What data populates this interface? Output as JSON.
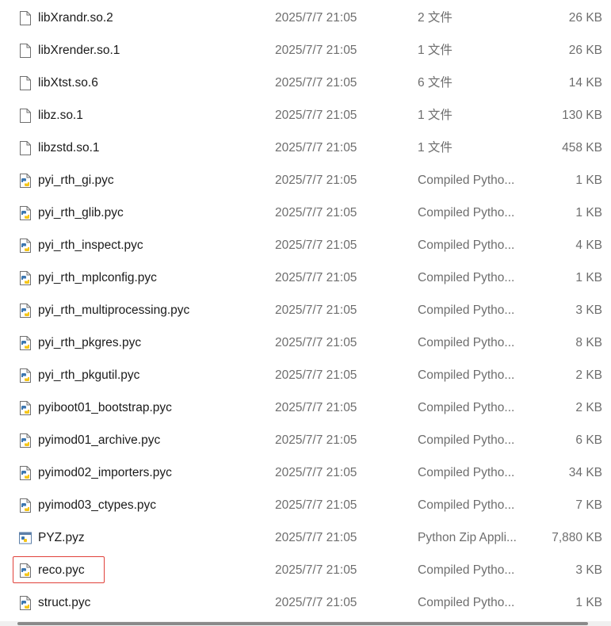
{
  "files": [
    {
      "name": "libXrandr.so.2",
      "date": "2025/7/7 21:05",
      "type": "2 文件",
      "size": "26 KB",
      "icon": "generic-file-icon"
    },
    {
      "name": "libXrender.so.1",
      "date": "2025/7/7 21:05",
      "type": "1 文件",
      "size": "26 KB",
      "icon": "generic-file-icon"
    },
    {
      "name": "libXtst.so.6",
      "date": "2025/7/7 21:05",
      "type": "6 文件",
      "size": "14 KB",
      "icon": "generic-file-icon"
    },
    {
      "name": "libz.so.1",
      "date": "2025/7/7 21:05",
      "type": "1 文件",
      "size": "130 KB",
      "icon": "generic-file-icon"
    },
    {
      "name": "libzstd.so.1",
      "date": "2025/7/7 21:05",
      "type": "1 文件",
      "size": "458 KB",
      "icon": "generic-file-icon"
    },
    {
      "name": "pyi_rth_gi.pyc",
      "date": "2025/7/7 21:05",
      "type": "Compiled Pytho...",
      "size": "1 KB",
      "icon": "python-compiled-file-icon"
    },
    {
      "name": "pyi_rth_glib.pyc",
      "date": "2025/7/7 21:05",
      "type": "Compiled Pytho...",
      "size": "1 KB",
      "icon": "python-compiled-file-icon"
    },
    {
      "name": "pyi_rth_inspect.pyc",
      "date": "2025/7/7 21:05",
      "type": "Compiled Pytho...",
      "size": "4 KB",
      "icon": "python-compiled-file-icon"
    },
    {
      "name": "pyi_rth_mplconfig.pyc",
      "date": "2025/7/7 21:05",
      "type": "Compiled Pytho...",
      "size": "1 KB",
      "icon": "python-compiled-file-icon"
    },
    {
      "name": "pyi_rth_multiprocessing.pyc",
      "date": "2025/7/7 21:05",
      "type": "Compiled Pytho...",
      "size": "3 KB",
      "icon": "python-compiled-file-icon"
    },
    {
      "name": "pyi_rth_pkgres.pyc",
      "date": "2025/7/7 21:05",
      "type": "Compiled Pytho...",
      "size": "8 KB",
      "icon": "python-compiled-file-icon"
    },
    {
      "name": "pyi_rth_pkgutil.pyc",
      "date": "2025/7/7 21:05",
      "type": "Compiled Pytho...",
      "size": "2 KB",
      "icon": "python-compiled-file-icon"
    },
    {
      "name": "pyiboot01_bootstrap.pyc",
      "date": "2025/7/7 21:05",
      "type": "Compiled Pytho...",
      "size": "2 KB",
      "icon": "python-compiled-file-icon"
    },
    {
      "name": "pyimod01_archive.pyc",
      "date": "2025/7/7 21:05",
      "type": "Compiled Pytho...",
      "size": "6 KB",
      "icon": "python-compiled-file-icon"
    },
    {
      "name": "pyimod02_importers.pyc",
      "date": "2025/7/7 21:05",
      "type": "Compiled Pytho...",
      "size": "34 KB",
      "icon": "python-compiled-file-icon"
    },
    {
      "name": "pyimod03_ctypes.pyc",
      "date": "2025/7/7 21:05",
      "type": "Compiled Pytho...",
      "size": "7 KB",
      "icon": "python-compiled-file-icon"
    },
    {
      "name": "PYZ.pyz",
      "date": "2025/7/7 21:05",
      "type": "Python Zip Appli...",
      "size": "7,880 KB",
      "icon": "python-zip-app-icon"
    },
    {
      "name": "reco.pyc",
      "date": "2025/7/7 21:05",
      "type": "Compiled Pytho...",
      "size": "3 KB",
      "icon": "python-compiled-file-icon",
      "highlighted": true
    },
    {
      "name": "struct.pyc",
      "date": "2025/7/7 21:05",
      "type": "Compiled Pytho...",
      "size": "1 KB",
      "icon": "python-compiled-file-icon"
    }
  ],
  "colors": {
    "highlight_border": "#e0413a",
    "name_text": "#1b1b1b",
    "meta_text": "#6e6e6e",
    "python_blue": "#3b76b0",
    "python_yellow": "#f5c518"
  }
}
